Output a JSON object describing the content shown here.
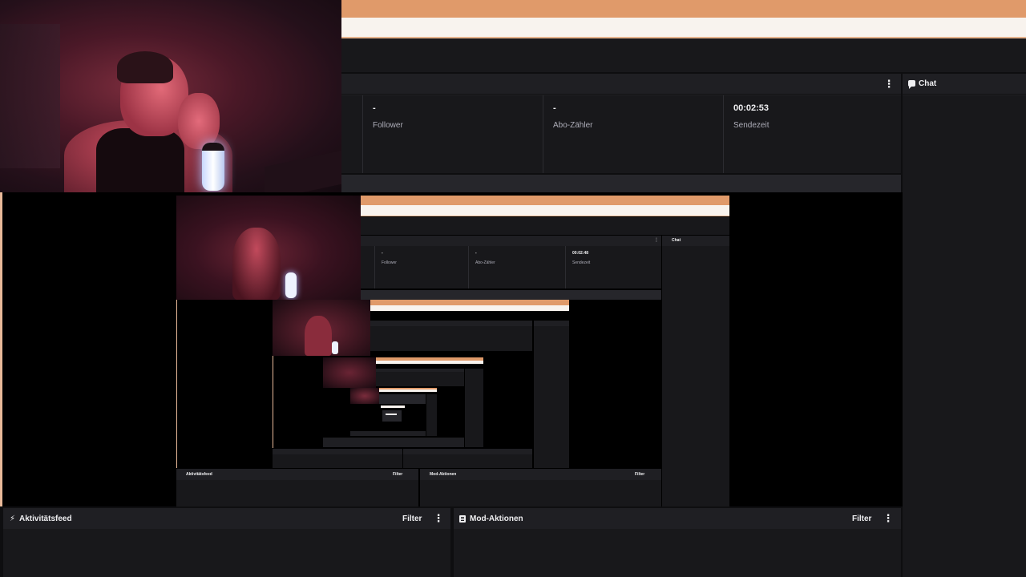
{
  "stats": {
    "cells": [
      {
        "value": "-",
        "label": "Follower"
      },
      {
        "value": "-",
        "label": "Abo-Zähler"
      },
      {
        "value": "00:02:53",
        "label": "Sendezeit"
      }
    ],
    "menu_icon": "kebab-icon"
  },
  "chat": {
    "title": "Chat",
    "icon": "chat-icon"
  },
  "activity_feed": {
    "title": "Aktivitätsfeed",
    "icon": "lightning-icon",
    "filter_label": "Filter"
  },
  "mod_actions": {
    "title": "Mod-Aktionen",
    "icon": "document-icon",
    "filter_label": "Filter"
  },
  "nested_preview": {
    "stats": [
      {
        "value": "-",
        "label": "Follower"
      },
      {
        "value": "-",
        "label": "Abo-Zähler"
      },
      {
        "value": "00:02:48",
        "label": "Sendezeit"
      }
    ],
    "chat_title": "Chat",
    "activity_feed_title": "Aktivitätsfeed",
    "mod_actions_title": "Mod-Aktionen",
    "filter_label": "Filter"
  },
  "colors": {
    "accent_orange": "#e09a6a",
    "cream": "#f8f3ee",
    "panel": "#1f1f23",
    "background": "#0e0e10"
  }
}
